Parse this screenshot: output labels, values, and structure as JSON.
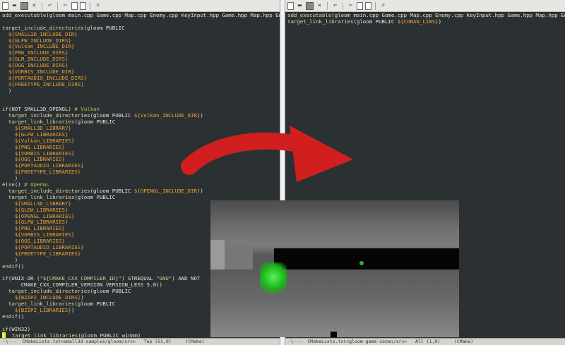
{
  "left": {
    "code": [
      [
        [
          "cmd",
          "add_executable"
        ],
        [
          "",
          "(gloom main.cpp Game.cpp Map.cpp Enemy.cpp KeyInput.hpp Game.hpp Map.hpp Enemy.hpp)"
        ]
      ],
      [
        [
          "",
          ""
        ]
      ],
      [
        [
          "cmd",
          "target_include_directories"
        ],
        [
          "",
          "(gloom PUBLIC"
        ]
      ],
      [
        [
          "",
          "  "
        ],
        [
          "var",
          "${SMALL3D_INCLUDE_DIR}"
        ]
      ],
      [
        [
          "",
          "  "
        ],
        [
          "var",
          "${GLFW_INCLUDE_DIRS}"
        ]
      ],
      [
        [
          "",
          "  "
        ],
        [
          "var",
          "${Vulkan_INCLUDE_DIR}"
        ]
      ],
      [
        [
          "",
          "  "
        ],
        [
          "var",
          "${PNG_INCLUDE_DIRS}"
        ]
      ],
      [
        [
          "",
          "  "
        ],
        [
          "var",
          "${GLM_INCLUDE_DIRS}"
        ]
      ],
      [
        [
          "",
          "  "
        ],
        [
          "var",
          "${OGG_INCLUDE_DIRS}"
        ]
      ],
      [
        [
          "",
          "  "
        ],
        [
          "var",
          "${VORBIS_INCLUDE_DIR}"
        ]
      ],
      [
        [
          "",
          "  "
        ],
        [
          "var",
          "${PORTAUDIO_INCLUDE_DIRS}"
        ]
      ],
      [
        [
          "",
          "  "
        ],
        [
          "var",
          "${FREETYPE_INCLUDE_DIRS}"
        ]
      ],
      [
        [
          "",
          "  )"
        ]
      ],
      [
        [
          "",
          ""
        ]
      ],
      [
        [
          "",
          ""
        ]
      ],
      [
        [
          "kw",
          "if"
        ],
        [
          "",
          "(NOT SMALL3D_OPENGL) "
        ],
        [
          "cm",
          "# Vulkan"
        ]
      ],
      [
        [
          "",
          "  "
        ],
        [
          "cmd",
          "target_include_directories"
        ],
        [
          "",
          "(gloom PUBLIC "
        ],
        [
          "var",
          "${Vulkan_INCLUDE_DIR}"
        ],
        [
          "",
          ")"
        ]
      ],
      [
        [
          "",
          "  "
        ],
        [
          "cmd",
          "target_link_libraries"
        ],
        [
          "",
          "(gloom PUBLIC"
        ]
      ],
      [
        [
          "",
          "    "
        ],
        [
          "var",
          "${SMALL3D_LIBRARY}"
        ]
      ],
      [
        [
          "",
          "    "
        ],
        [
          "var",
          "${GLFW_LIBRARIES}"
        ]
      ],
      [
        [
          "",
          "    "
        ],
        [
          "var",
          "${Vulkan_LIBRARIES}"
        ]
      ],
      [
        [
          "",
          "    "
        ],
        [
          "var",
          "${PNG_LIBRARIES}"
        ]
      ],
      [
        [
          "",
          "    "
        ],
        [
          "var",
          "${VORBIS_LIBRARIES}"
        ]
      ],
      [
        [
          "",
          "    "
        ],
        [
          "var",
          "${OGG_LIBRARIES}"
        ]
      ],
      [
        [
          "",
          "    "
        ],
        [
          "var",
          "${PORTAUDIO_LIBRARIES}"
        ]
      ],
      [
        [
          "",
          "    "
        ],
        [
          "var",
          "${FREETYPE_LIBRARIES}"
        ]
      ],
      [
        [
          "",
          "    )"
        ]
      ],
      [
        [
          "kw",
          "else"
        ],
        [
          "",
          "() "
        ],
        [
          "cm",
          "# OpenGL"
        ]
      ],
      [
        [
          "",
          "  "
        ],
        [
          "cmd",
          "target_include_directories"
        ],
        [
          "",
          "(gloom PUBLIC "
        ],
        [
          "var",
          "${OPENGL_INCLUDE_DIR}"
        ],
        [
          "",
          ")"
        ]
      ],
      [
        [
          "",
          "  "
        ],
        [
          "cmd",
          "target_link_libraries"
        ],
        [
          "",
          "(gloom PUBLIC"
        ]
      ],
      [
        [
          "",
          "    "
        ],
        [
          "var",
          "${SMALL3D_LIBRARY}"
        ]
      ],
      [
        [
          "",
          "    "
        ],
        [
          "var",
          "${GLEW_LIBRARIES}"
        ]
      ],
      [
        [
          "",
          "    "
        ],
        [
          "var",
          "${OPENGL_LIBRARIES}"
        ]
      ],
      [
        [
          "",
          "    "
        ],
        [
          "var",
          "${GLFW_LIBRARIES}"
        ]
      ],
      [
        [
          "",
          "    "
        ],
        [
          "var",
          "${PNG_LIBRARIES}"
        ]
      ],
      [
        [
          "",
          "    "
        ],
        [
          "var",
          "${VORBIS_LIBRARIES}"
        ]
      ],
      [
        [
          "",
          "    "
        ],
        [
          "var",
          "${OGG_LIBRARIES}"
        ]
      ],
      [
        [
          "",
          "    "
        ],
        [
          "var",
          "${PORTAUDIO_LIBRARIES}"
        ]
      ],
      [
        [
          "",
          "    "
        ],
        [
          "var",
          "${FREETYPE_LIBRARIES}"
        ]
      ],
      [
        [
          "",
          "    )"
        ]
      ],
      [
        [
          "kw",
          "endif"
        ],
        [
          "",
          "()"
        ]
      ],
      [
        [
          "",
          ""
        ]
      ],
      [
        [
          "kw",
          "if"
        ],
        [
          "",
          "(UNIX OR ("
        ],
        [
          "str",
          "\"${CMAKE_CXX_COMPILER_ID}\""
        ],
        [
          "",
          ") STREQUAL "
        ],
        [
          "str",
          "\"GNU\""
        ],
        [
          "",
          ") AND NOT"
        ]
      ],
      [
        [
          "",
          "      CMAKE_CXX_COMPILER_VERSION VERSION_LESS 5.0))"
        ]
      ],
      [
        [
          "",
          "  "
        ],
        [
          "cmd",
          "target_include_directories"
        ],
        [
          "",
          "(gloom PUBLIC"
        ]
      ],
      [
        [
          "",
          "    "
        ],
        [
          "var",
          "${BZIP2_INCLUDE_DIRS}"
        ],
        [
          "",
          ")"
        ]
      ],
      [
        [
          "",
          "  "
        ],
        [
          "cmd",
          "target_link_libraries"
        ],
        [
          "",
          "(gloom PUBLIC"
        ]
      ],
      [
        [
          "",
          "    "
        ],
        [
          "var",
          "${BZIP2_LIBRARIES}"
        ],
        [
          "",
          ")"
        ]
      ],
      [
        [
          "kw",
          "endif"
        ],
        [
          "",
          "()"
        ]
      ],
      [
        [
          "",
          ""
        ]
      ],
      [
        [
          "kw",
          "if"
        ],
        [
          "",
          "(WIN32)"
        ]
      ],
      [
        [
          "",
          "  "
        ],
        [
          "cmd",
          "target_link_libraries"
        ],
        [
          "",
          "(gloom PUBLIC winmm)"
        ]
      ]
    ],
    "modeline": "-\\---  CMakeLists.txt<small3d-samples/gloom/src>   Top (51,0)     (CMake)"
  },
  "right": {
    "code": [
      [
        [
          "cmd",
          "add_executable"
        ],
        [
          "",
          "(gloom main.cpp Game.cpp Map.cpp Enemy.cpp KeyInput.hpp Game.hpp Map.hpp Enemy.hpp)"
        ]
      ],
      [
        [
          "cmd",
          "target_link_libraries"
        ],
        [
          "",
          "(gloom PUBLIC "
        ],
        [
          "var",
          "${CONAN_LIBS}"
        ],
        [
          "",
          ")"
        ]
      ]
    ],
    "modeline": "-\\---  CMakeLists.txt<gloom-game-conan/src>   All (1,0)     (CMake)"
  },
  "colors": {
    "editor_bg": "#2b3133",
    "command": "#e3d6a0",
    "variable": "#f0a030",
    "comment": "#b3c53a",
    "arrow": "#d11f1f"
  },
  "toolbar_icons": [
    "new-file-icon",
    "open-folder-icon",
    "save-icon",
    "close-icon",
    "undo-icon",
    "cut-icon",
    "copy-icon",
    "paste-icon",
    "search-icon"
  ]
}
